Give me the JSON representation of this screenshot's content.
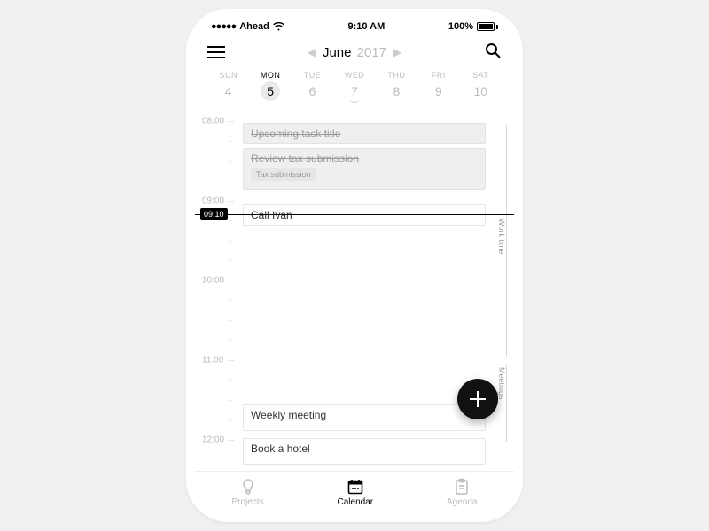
{
  "status_bar": {
    "carrier": "Ahead",
    "time": "9:10 AM",
    "battery": "100%"
  },
  "header": {
    "month": "June",
    "year": "2017"
  },
  "week": {
    "days": [
      {
        "name": "SUN",
        "num": "4"
      },
      {
        "name": "MON",
        "num": "5"
      },
      {
        "name": "TUE",
        "num": "6"
      },
      {
        "name": "WED",
        "num": "7"
      },
      {
        "name": "THU",
        "num": "8"
      },
      {
        "name": "FRI",
        "num": "9"
      },
      {
        "name": "SAT",
        "num": "10"
      }
    ],
    "selected_index": 1
  },
  "timeline": {
    "hours": [
      "08:00",
      "09:00",
      "10:00",
      "11:00",
      "12:00"
    ],
    "now_label": "09:10",
    "events": [
      {
        "title": "Upcoming task title"
      },
      {
        "title": "Review tax submission",
        "tag": "Tax submission"
      },
      {
        "title": "Call Ivan"
      },
      {
        "title": "Weekly meeting"
      },
      {
        "title": "Book a hotel"
      }
    ],
    "side_tracks": [
      {
        "label": "Work time"
      },
      {
        "label": "Meetings"
      }
    ]
  },
  "bottom_nav": {
    "items": [
      {
        "label": "Projects"
      },
      {
        "label": "Calendar"
      },
      {
        "label": "Agenda"
      }
    ],
    "active_index": 1
  }
}
